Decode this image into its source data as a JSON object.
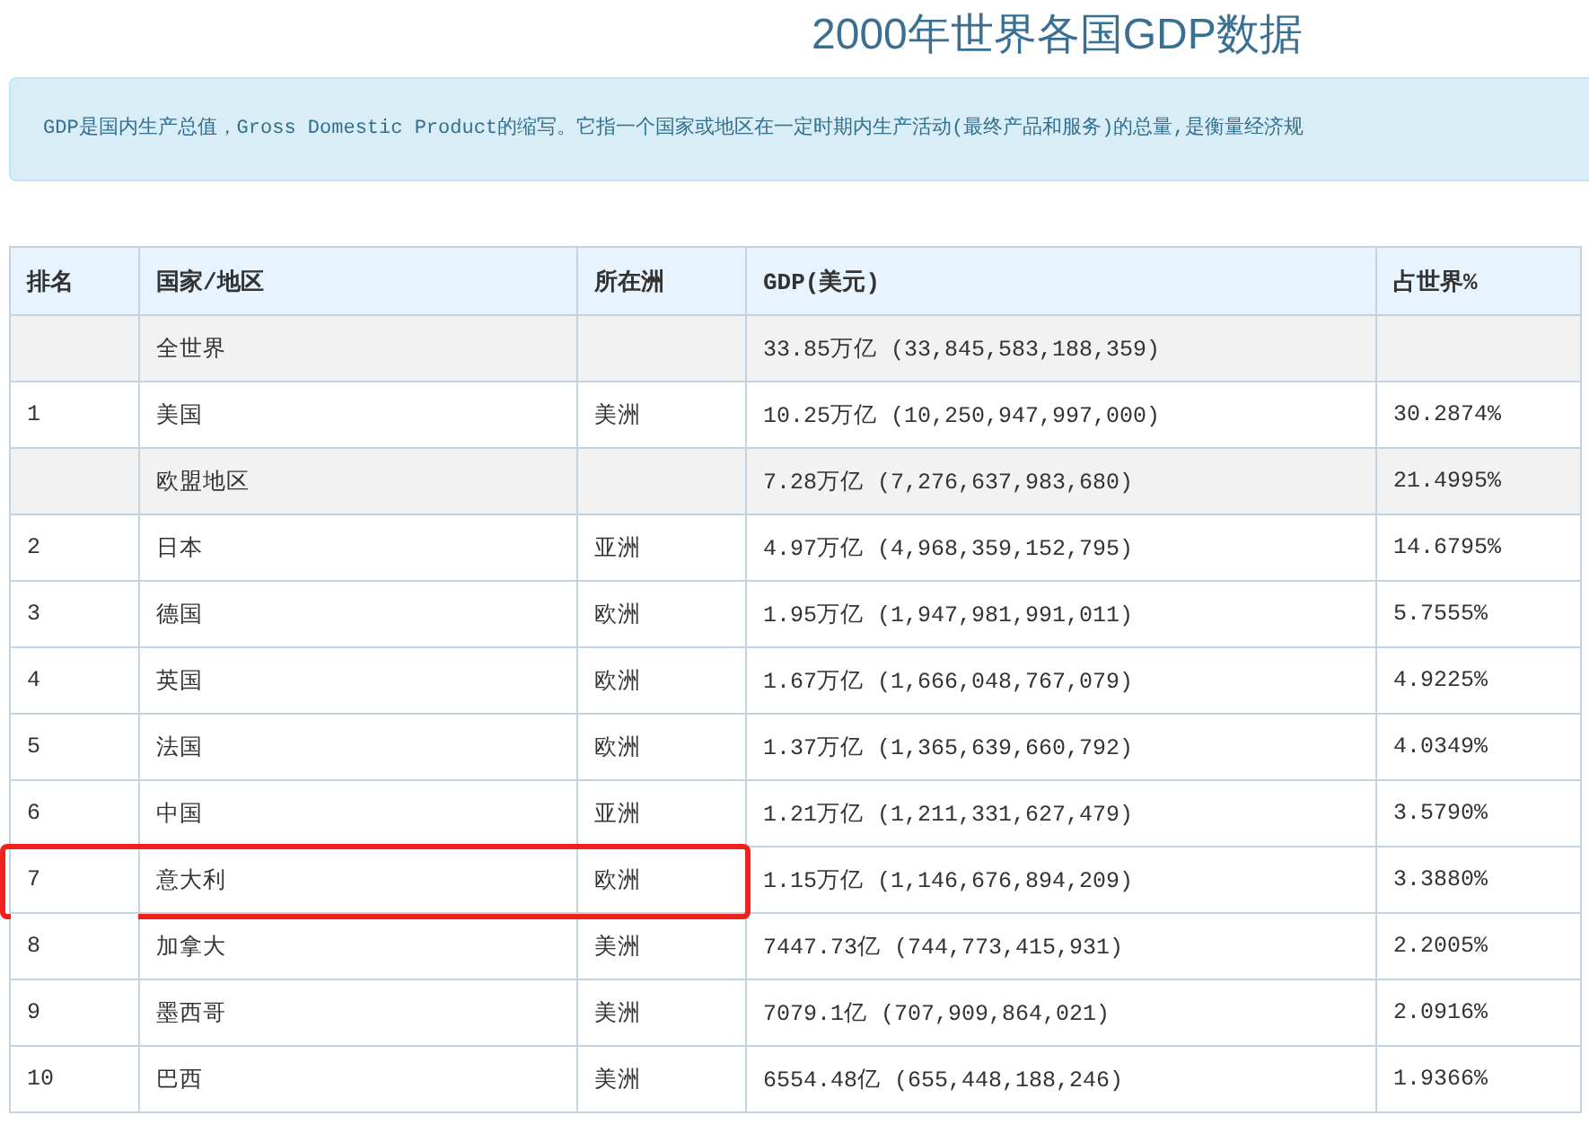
{
  "title": "2000年世界各国GDP数据",
  "notice": "GDP是国内生产总值，Gross Domestic Product的缩写。它指一个国家或地区在一定时期内生产活动(最终产品和服务)的总量,是衡量经济规",
  "table": {
    "columns": [
      "排名",
      "国家/地区",
      "所在洲",
      "GDP(美元)",
      "占世界%"
    ],
    "rows": [
      {
        "kind": "aggregate",
        "highlighted": false,
        "cells": [
          "",
          "全世界",
          "",
          "33.85万亿 (33,845,583,188,359)",
          ""
        ]
      },
      {
        "kind": "country",
        "highlighted": false,
        "cells": [
          "1",
          "美国",
          "美洲",
          "10.25万亿 (10,250,947,997,000)",
          "30.2874%"
        ]
      },
      {
        "kind": "aggregate",
        "highlighted": false,
        "cells": [
          "",
          "欧盟地区",
          "",
          "7.28万亿 (7,276,637,983,680)",
          "21.4995%"
        ]
      },
      {
        "kind": "country",
        "highlighted": false,
        "cells": [
          "2",
          "日本",
          "亚洲",
          "4.97万亿 (4,968,359,152,795)",
          "14.6795%"
        ]
      },
      {
        "kind": "country",
        "highlighted": false,
        "cells": [
          "3",
          "德国",
          "欧洲",
          "1.95万亿 (1,947,981,991,011)",
          "5.7555%"
        ]
      },
      {
        "kind": "country",
        "highlighted": false,
        "cells": [
          "4",
          "英国",
          "欧洲",
          "1.67万亿 (1,666,048,767,079)",
          "4.9225%"
        ]
      },
      {
        "kind": "country",
        "highlighted": false,
        "cells": [
          "5",
          "法国",
          "欧洲",
          "1.37万亿 (1,365,639,660,792)",
          "4.0349%"
        ]
      },
      {
        "kind": "country",
        "highlighted": false,
        "cells": [
          "6",
          "中国",
          "亚洲",
          "1.21万亿 (1,211,331,627,479)",
          "3.5790%"
        ]
      },
      {
        "kind": "country",
        "highlighted": true,
        "cells": [
          "7",
          "意大利",
          "欧洲",
          "1.15万亿 (1,146,676,894,209)",
          "3.3880%"
        ]
      },
      {
        "kind": "country",
        "highlighted": false,
        "cells": [
          "8",
          "加拿大",
          "美洲",
          "7447.73亿 (744,773,415,931)",
          "2.2005%"
        ]
      },
      {
        "kind": "country",
        "highlighted": false,
        "cells": [
          "9",
          "墨西哥",
          "美洲",
          "7079.1亿 (707,909,864,021)",
          "2.0916%"
        ]
      },
      {
        "kind": "country",
        "highlighted": false,
        "cells": [
          "10",
          "巴西",
          "美洲",
          "6554.48亿 (655,448,188,246)",
          "1.9366%"
        ]
      }
    ]
  }
}
